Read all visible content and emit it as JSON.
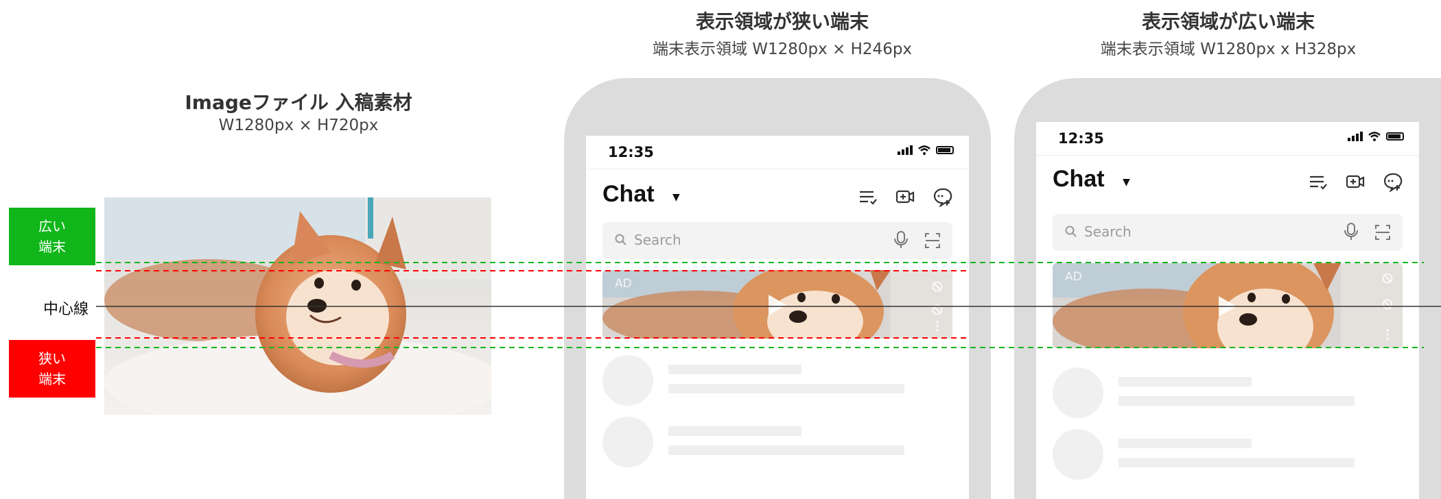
{
  "source": {
    "title": "Imageファイル 入稿素材",
    "subtitle": "W1280px × H720px"
  },
  "narrow": {
    "title": "表示領域が狭い端末",
    "subtitle": "端末表示領域 W1280px × H246px"
  },
  "wide": {
    "title": "表示領域が広い端末",
    "subtitle": "端末表示領域 W1280px x H328px"
  },
  "legend": {
    "wide_tag": "広い\n端末",
    "narrow_tag": "狭い\n端末",
    "center_line": "中心線"
  },
  "phone": {
    "time": "12:35",
    "chat_title": "Chat",
    "search_placeholder": "Search",
    "ad_label": "AD"
  },
  "colors": {
    "wide_guide": "#10b61a",
    "narrow_guide": "#ff0000",
    "center_line": "#333333",
    "phone_frame": "#dcdcdc"
  },
  "icons": [
    "list-check-icon",
    "video-plus-icon",
    "chat-plus-icon",
    "search-icon",
    "mic-icon",
    "scan-icon",
    "play-icon",
    "block-icon",
    "more-icon"
  ]
}
